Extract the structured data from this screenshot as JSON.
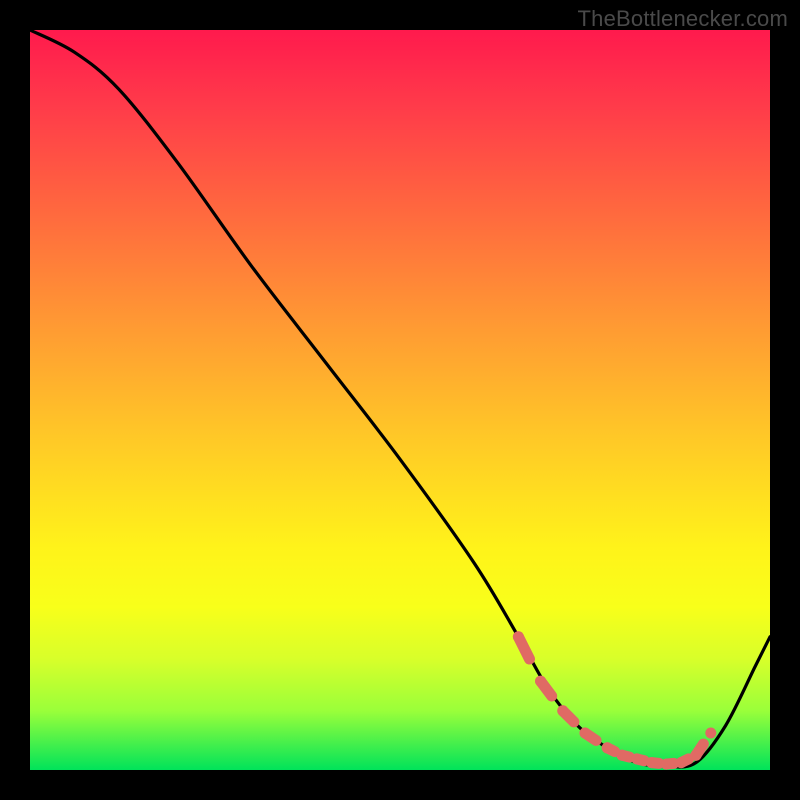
{
  "watermark": "TheBottlenecker.com",
  "colors": {
    "frame": "#000000",
    "gradient_top": "#ff1a4d",
    "gradient_bottom": "#00e35a",
    "curve_stroke": "#000000",
    "marker_fill": "#e06a64",
    "marker_stroke": "#b84f49"
  },
  "chart_data": {
    "type": "line",
    "title": "",
    "xlabel": "",
    "ylabel": "",
    "xlim": [
      0,
      100
    ],
    "ylim": [
      0,
      100
    ],
    "series": [
      {
        "name": "bottleneck-curve",
        "x": [
          0,
          6,
          12,
          20,
          30,
          40,
          50,
          60,
          66,
          70,
          74,
          78,
          82,
          86,
          90,
          94,
          98,
          100
        ],
        "y": [
          100,
          97,
          92,
          82,
          68,
          55,
          42,
          28,
          18,
          11,
          6,
          3,
          1,
          0.5,
          1,
          6,
          14,
          18
        ]
      }
    ],
    "markers": {
      "name": "highlighted-range",
      "x": [
        66,
        69,
        72,
        75,
        78,
        80,
        82,
        84,
        86,
        88,
        90,
        92
      ],
      "y": [
        18,
        12,
        8,
        5,
        3,
        2,
        1.5,
        1,
        0.8,
        1,
        2,
        5
      ]
    }
  }
}
